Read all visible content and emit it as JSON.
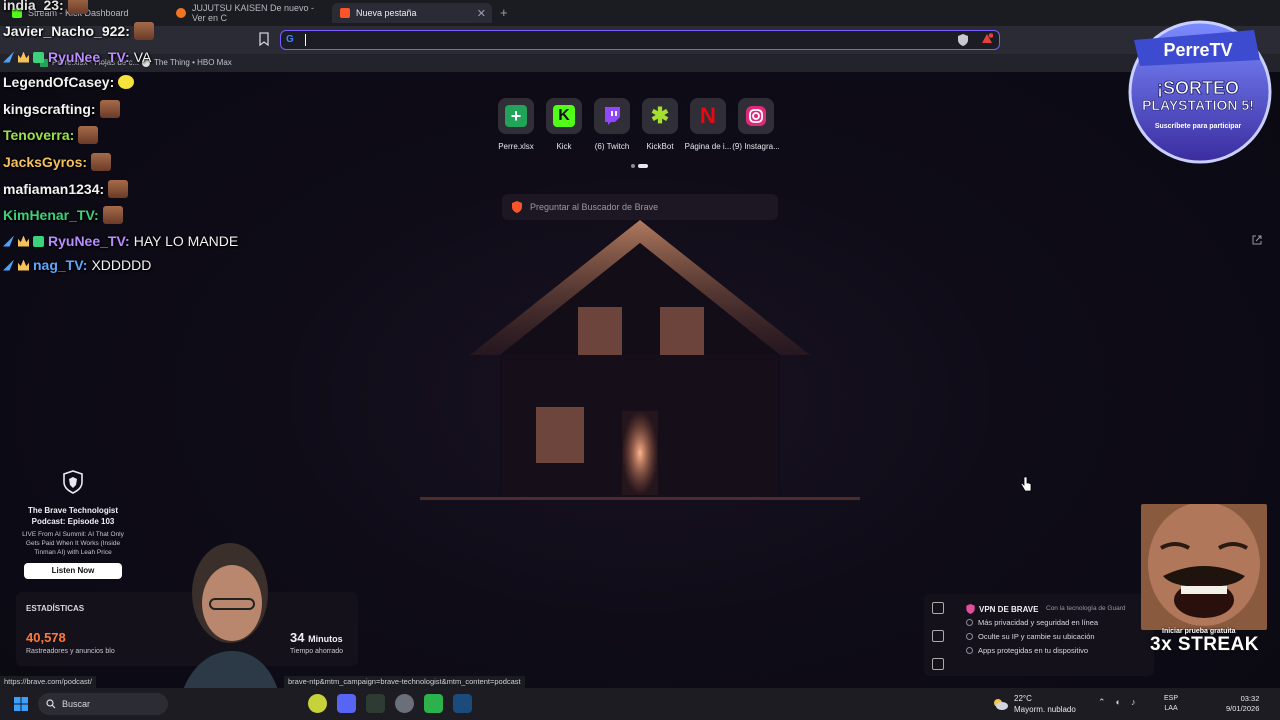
{
  "browser": {
    "tabs": [
      {
        "title": "Stream - Kick Dashboard",
        "active": false
      },
      {
        "title": "JUJUTSU KAISEN De nuevo - Ver en C",
        "active": false
      },
      {
        "title": "Nueva pestaña",
        "active": true
      }
    ],
    "address_value": "",
    "bookmarks": [
      {
        "label": "Perre.xlsx - Hojas de c..."
      },
      {
        "label": "The Thing • HBO Max"
      }
    ]
  },
  "newtab": {
    "quick_links": [
      {
        "label": "Perre.xlsx",
        "icon": "sheets-plus-icon",
        "color": "#21a35a"
      },
      {
        "label": "Kick",
        "icon": "kick-icon",
        "color": "#53fc18"
      },
      {
        "label": "(6) Twitch",
        "icon": "twitch-icon",
        "color": "#9146ff"
      },
      {
        "label": "KickBot",
        "icon": "kickbot-icon",
        "color": "#a4e02f"
      },
      {
        "label": "Página de i...",
        "icon": "netflix-icon",
        "color": "#e50914"
      },
      {
        "label": "(9) Instagra...",
        "icon": "instagram-icon",
        "color": "#dd2a7b"
      }
    ],
    "search_placeholder": "Preguntar al Buscador de Brave",
    "podcast": {
      "title": "The Brave Technologist Podcast: Episode 103",
      "description": "LIVE From AI Summit: AI That Only Gets Paid When It Works (Inside Tinman AI) with Leah Price",
      "button": "Listen Now"
    },
    "stats": {
      "header": "ESTADÍSTICAS",
      "trackers_value": "40,578",
      "trackers_label": "Rastreadores y anuncios blo",
      "time_value": "34",
      "time_unit": "Minutos",
      "time_label": "Tiempo ahorrado"
    },
    "vpn": {
      "title": "VPN DE BRAVE",
      "powered": "Con la tecnología de Guard",
      "features": [
        "Más privacidad y seguridad en línea",
        "Oculte su IP y cambie su ubicación",
        "Apps protegidas en tu dispositivo"
      ]
    }
  },
  "chat": {
    "messages": [
      {
        "user": "india_23:",
        "color": "#e0e0e0",
        "text": ""
      },
      {
        "user": "Javier_Nacho_922:",
        "color": "#f2f2f2",
        "text": ""
      },
      {
        "user": "RyuNee_TV:",
        "color": "#b98cff",
        "text": "VA"
      },
      {
        "user": "LegendOfCasey:",
        "color": "#f2f2f2",
        "text": ""
      },
      {
        "user": "kingscrafting:",
        "color": "#f2f2f2",
        "text": ""
      },
      {
        "user": "Tenoverra:",
        "color": "#9be04a",
        "text": ""
      },
      {
        "user": "JacksGyros:",
        "color": "#f5c15c",
        "text": ""
      },
      {
        "user": "mafiaman1234:",
        "color": "#f2f2f2",
        "text": ""
      },
      {
        "user": "KimHenar_TV:",
        "color": "#3cd17a",
        "text": ""
      },
      {
        "user": "RyuNee_TV:",
        "color": "#b98cff",
        "text": "HAY LO MANDE"
      },
      {
        "user": "nag_TV:",
        "color": "#5aa7ff",
        "text": "XDDDDD"
      }
    ]
  },
  "overlay": {
    "perre_brand": "PerreTV",
    "perre_line1": "¡SORTEO",
    "perre_line2": "PLAYSTATION 5!",
    "perre_line3": "Suscríbete para participar",
    "streak_top": "Iniciar prueba gratuita",
    "streak": "3x STREAK"
  },
  "status": {
    "url_left": "https://brave.com/podcast/",
    "url_right": "brave-ntp&mtm_campaign=brave-technologist&mtm_content=podcast"
  },
  "taskbar": {
    "search_label": "Buscar",
    "weather_temp": "22°C",
    "weather_desc": "Mayorm. nublado",
    "lang1": "ESP",
    "lang2": "LAA",
    "time": "03:32",
    "date": "9/01/2026"
  }
}
